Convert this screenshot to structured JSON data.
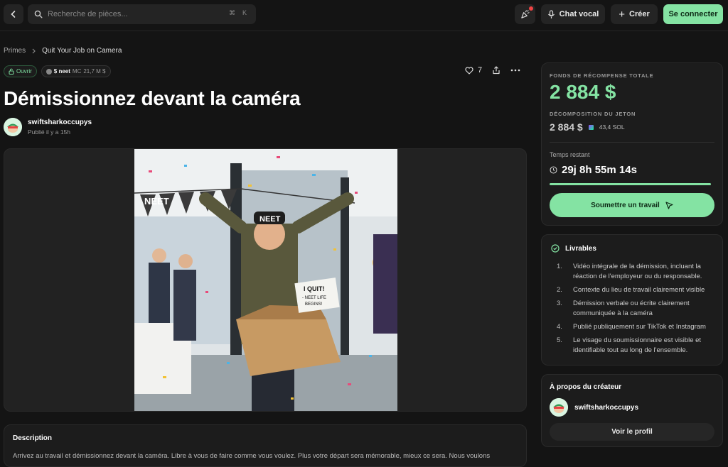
{
  "header": {
    "search_placeholder": "Recherche de pièces...",
    "kbd_cmd": "⌘",
    "kbd_k": "K",
    "voice_label": "Chat vocal",
    "create_label": "Créer",
    "connect_label": "Se connecter"
  },
  "breadcrumb": {
    "root": "Primes",
    "current": "Quit Your Job on Camera"
  },
  "badges": {
    "status": "Ouvrir",
    "token": "$ neet",
    "mc_label": "MC",
    "mc_value": "21,7 M $"
  },
  "actions": {
    "likes": "7"
  },
  "bounty": {
    "title": "Démissionnez devant la caméra",
    "author": "swiftsharkoccupys",
    "published": "Publié il y a 15h",
    "image_texts": {
      "bunting": "NEET",
      "cap": "NEET",
      "sign_line1": "I QUIT!",
      "sign_line2": "- NEET LIFE",
      "sign_line3": "BEGINS!"
    }
  },
  "description": {
    "title": "Description",
    "text": "Arrivez au travail et démissionnez devant la caméra. Libre à vous de faire comme vous voulez. Plus votre départ sera mémorable, mieux ce sera. Nous voulons"
  },
  "reward": {
    "label": "FONDS DE RÉCOMPENSE TOTALE",
    "amount": "2 884 $",
    "breakdown_label": "DÉCOMPOSITION DU JETON",
    "breakdown_usd": "2 884 $",
    "breakdown_sol": "43,4 SOL",
    "time_label": "Temps restant",
    "time_value": "29j 8h 55m 14s",
    "progress": 0.98,
    "submit_label": "Soumettre un travail"
  },
  "deliverables": {
    "title": "Livrables",
    "items": [
      {
        "n": "1.",
        "text": "Vidéo intégrale de la démission, incluant la réaction de l'employeur ou du responsable."
      },
      {
        "n": "2.",
        "text": "Contexte du lieu de travail clairement visible"
      },
      {
        "n": "3.",
        "text": "Démission verbale ou écrite clairement communiquée à la caméra"
      },
      {
        "n": "4.",
        "text": "Publié publiquement sur TikTok et Instagram"
      },
      {
        "n": "5.",
        "text": "Le visage du soumissionnaire est visible et identifiable tout au long de l'ensemble."
      }
    ]
  },
  "creator": {
    "title": "À propos du créateur",
    "name": "swiftsharkoccupys",
    "profile_label": "Voir le profil"
  },
  "colors": {
    "accent": "#84e3a3",
    "background": "#141414",
    "card": "#1c1c1c"
  }
}
